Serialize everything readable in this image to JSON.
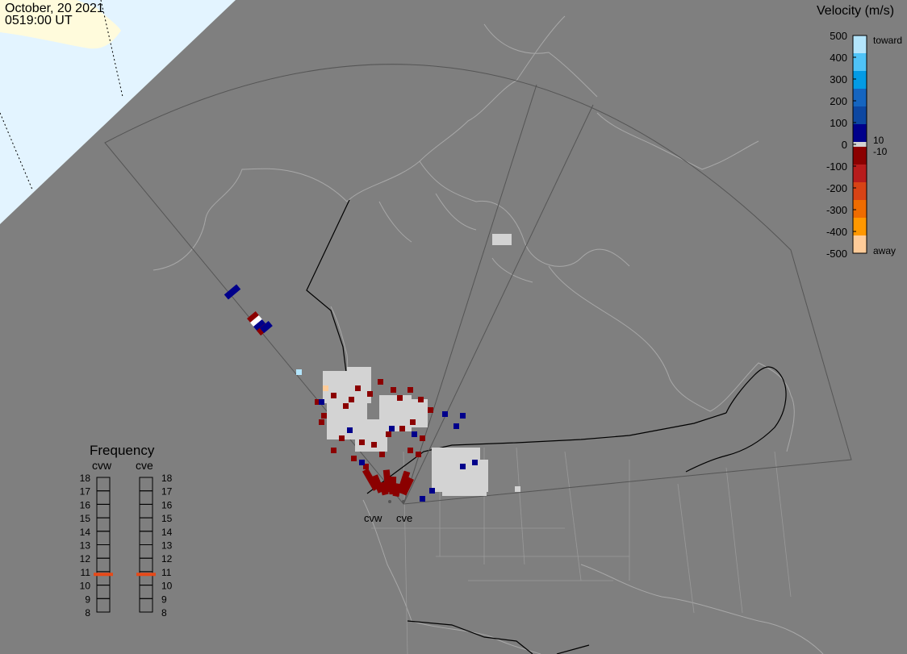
{
  "header": {
    "date": "October, 20 2021",
    "time": "0519:00 UT"
  },
  "velocity_scale": {
    "title": "Velocity (m/s)",
    "tick_labels": [
      "500",
      "400",
      "300",
      "200",
      "100",
      "0",
      "-100",
      "-200",
      "-300",
      "-400",
      "-500"
    ],
    "end_labels": [
      "toward",
      "away"
    ],
    "threshold_labels": [
      "10",
      "-10"
    ],
    "colors": [
      "#b3e5fc",
      "#4fc3f7",
      "#039be5",
      "#1565c0",
      "#0d47a1",
      "#00008b",
      "#8b0000",
      "#b71c1c",
      "#d84315",
      "#ef6c00",
      "#ff9800",
      "#ffcc99"
    ],
    "band_color": "#d3d3d3"
  },
  "frequency": {
    "title": "Frequency",
    "radars": [
      "cvw",
      "cve"
    ],
    "ticks": [
      "18",
      "17",
      "16",
      "15",
      "14",
      "13",
      "12",
      "11",
      "10",
      "9",
      "8"
    ],
    "current_mhz": 10.8,
    "marker_color": "#e64a19"
  },
  "radar_sites": [
    "cvw",
    "cve"
  ],
  "colors": {
    "background": "#7f7f7f",
    "outlines": "#a8a8a8",
    "borders": "#000000",
    "daylight": "#e3f4ff",
    "land_day": "#fffbdc",
    "ground_scatter": "#d3d3d3"
  }
}
